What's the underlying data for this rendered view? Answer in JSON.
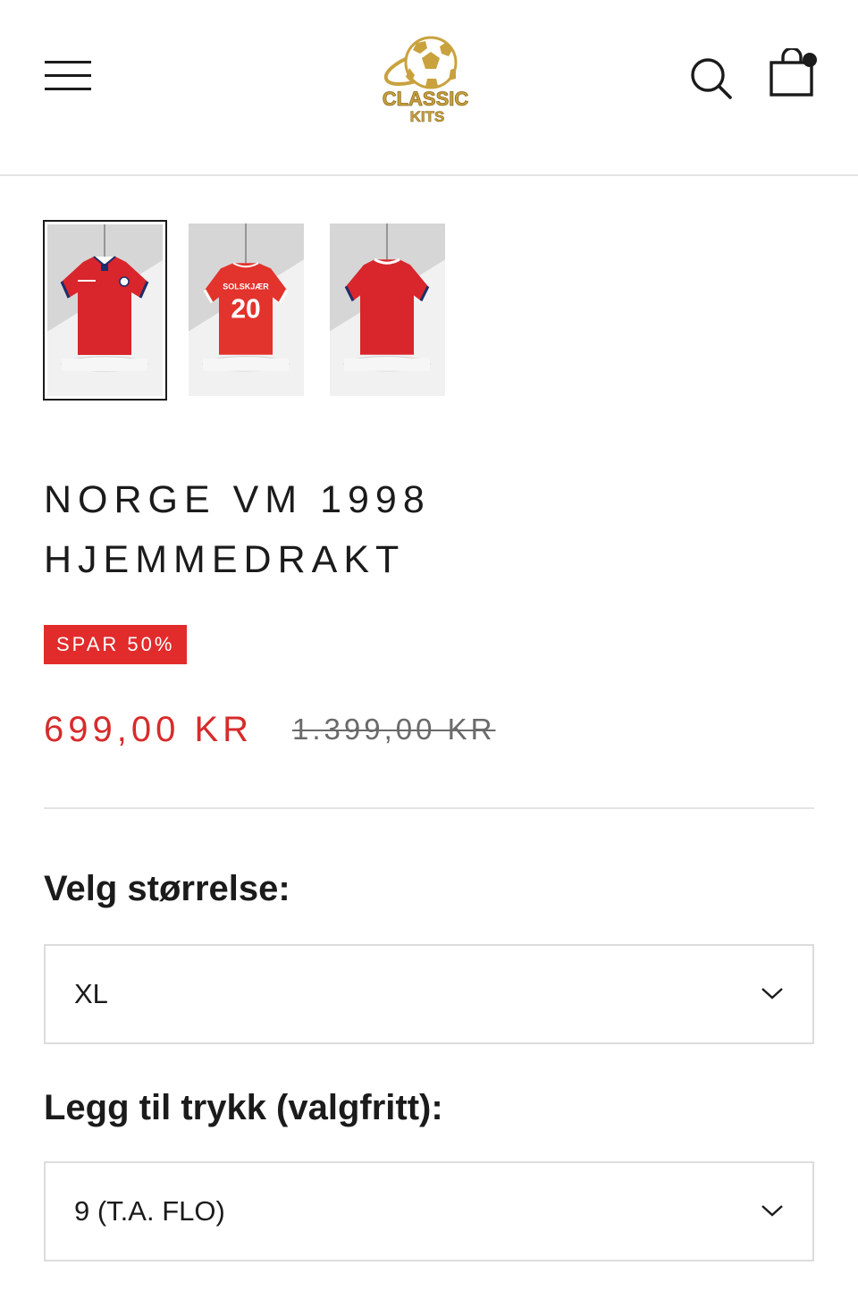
{
  "header": {
    "menu_icon": "hamburger-icon",
    "logo_text_line1": "CLASSIC",
    "logo_text_line2": "KITS",
    "search_icon": "search-icon",
    "cart_icon": "shopping-bag-icon"
  },
  "gallery": {
    "thumbnails": [
      {
        "view": "front",
        "active": true
      },
      {
        "view": "back",
        "active": false,
        "print_name": "SOLSKJÆR",
        "print_number": "20"
      },
      {
        "view": "back-plain",
        "active": false
      }
    ]
  },
  "product": {
    "title_line1": "NORGE VM 1998",
    "title_line2": "HJEMMEDRAKT",
    "badge": "SPAR 50%",
    "price_sale": "699,00 KR",
    "price_old": "1.399,00 KR"
  },
  "options": {
    "size_label": "Velg størrelse:",
    "size_value": "XL",
    "print_label": "Legg til trykk (valgfritt):",
    "print_value": "9 (T.A. FLO)"
  },
  "colors": {
    "accent": "#e22b2b",
    "text": "#1c1b1b",
    "logo_gold": "#c9a23e",
    "kit_red": "#d8262c"
  }
}
